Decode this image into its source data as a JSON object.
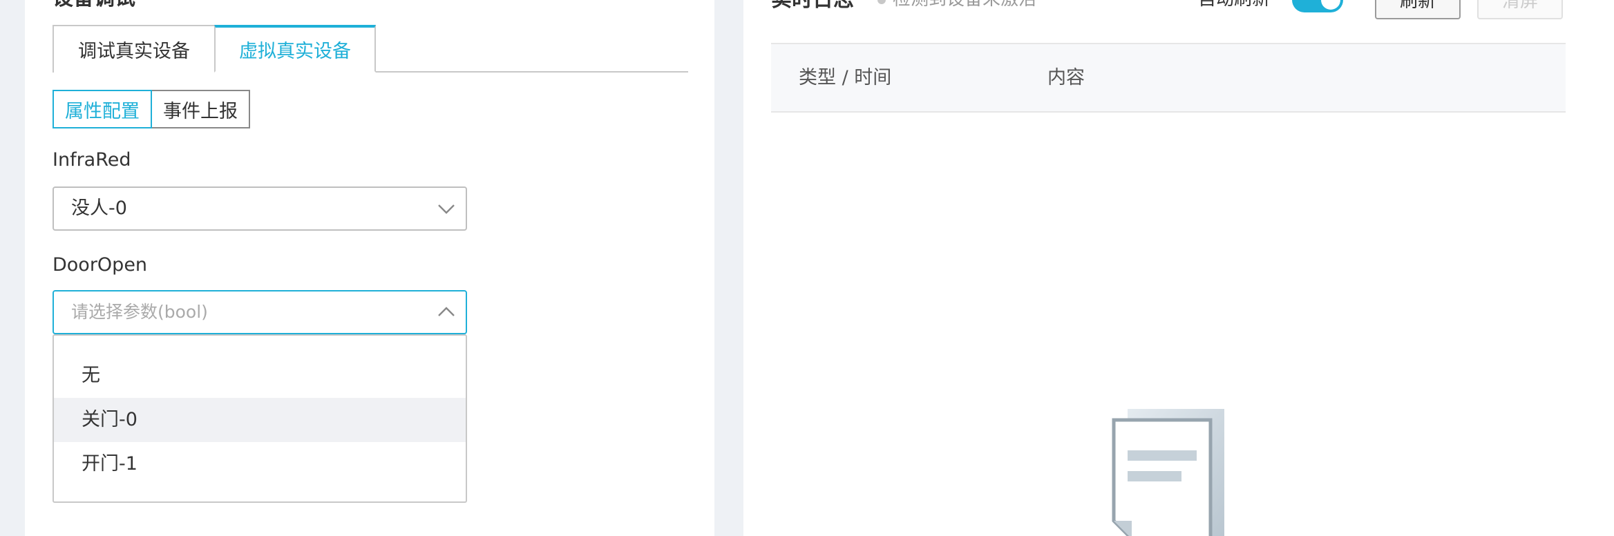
{
  "left_panel": {
    "heading": "设备调试",
    "tabs": [
      {
        "label": "调试真实设备",
        "active": false
      },
      {
        "label": "虚拟真实设备",
        "active": true
      }
    ],
    "segments": [
      {
        "label": "属性配置",
        "active": true
      },
      {
        "label": "事件上报",
        "active": false
      }
    ],
    "fields": {
      "infrared": {
        "label": "InfraRed",
        "value": "没人-0"
      },
      "door_open": {
        "label": "DoorOpen",
        "placeholder": "请选择参数(bool)",
        "options": [
          "无",
          "关门-0",
          "开门-1"
        ],
        "hovered_option": "关门-0"
      }
    }
  },
  "right_panel": {
    "title": "实时日志",
    "status": "检测到设备未激活",
    "auto_refresh_label": "自动刷新",
    "auto_refresh_on": true,
    "refresh_button": "刷新",
    "clear_button": "清屏",
    "columns": [
      "类型 / 时间",
      "内容"
    ]
  },
  "colors": {
    "accent": "#1fb0d8",
    "background": "#eef1f5",
    "header_bg": "#f7f8fa"
  }
}
